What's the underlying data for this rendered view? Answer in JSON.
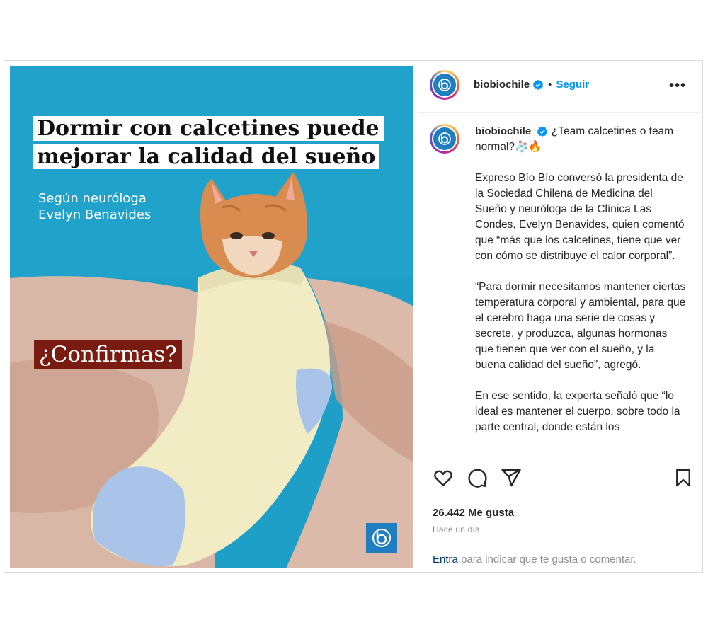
{
  "account": {
    "username": "biobiochile",
    "follow_label": "Seguir",
    "separator": "•",
    "more_label": "•••"
  },
  "image": {
    "headline_line1": "Dormir con calcetines puede",
    "headline_line2": "mejorar la calidad del sueño",
    "subline_line1": "Según neuróloga",
    "subline_line2": "Evelyn Benavides",
    "question": "¿Confirmas?"
  },
  "caption": {
    "username": "biobiochile",
    "intro": "¿Team calcetines o team normal?🧦🔥",
    "paragraph1": "Expreso Bío Bío conversó la presidenta de la Sociedad Chilena de Medicina del Sueño y neuróloga de la Clínica Las Condes, Evelyn Benavides, quien comentó que “más que los calcetines, tiene que ver con cómo se distribuye el calor corporal”.",
    "paragraph2": "“Para dormir necesitamos mantener ciertas temperatura corporal y ambiental, para que el cerebro haga una serie de cosas y secrete, y produzca, algunas hormonas que tienen que ver con el sueño, y la buena calidad del sueño”, agregó.",
    "paragraph3": "En ese sentido, la experta señaló que “lo ideal es mantener el cuerpo, sobre todo la parte central, donde están los"
  },
  "stats": {
    "likes": "26.442 Me gusta",
    "time_ago": "Hace un día"
  },
  "comment": {
    "login_link": "Entra",
    "rest": " para indicar que te gusta o comentar."
  },
  "colors": {
    "accent": "#0095f6",
    "brand_blue": "#1f7ec0",
    "image_bg": "#1e9fc7",
    "question_bg": "#7a1b12"
  }
}
